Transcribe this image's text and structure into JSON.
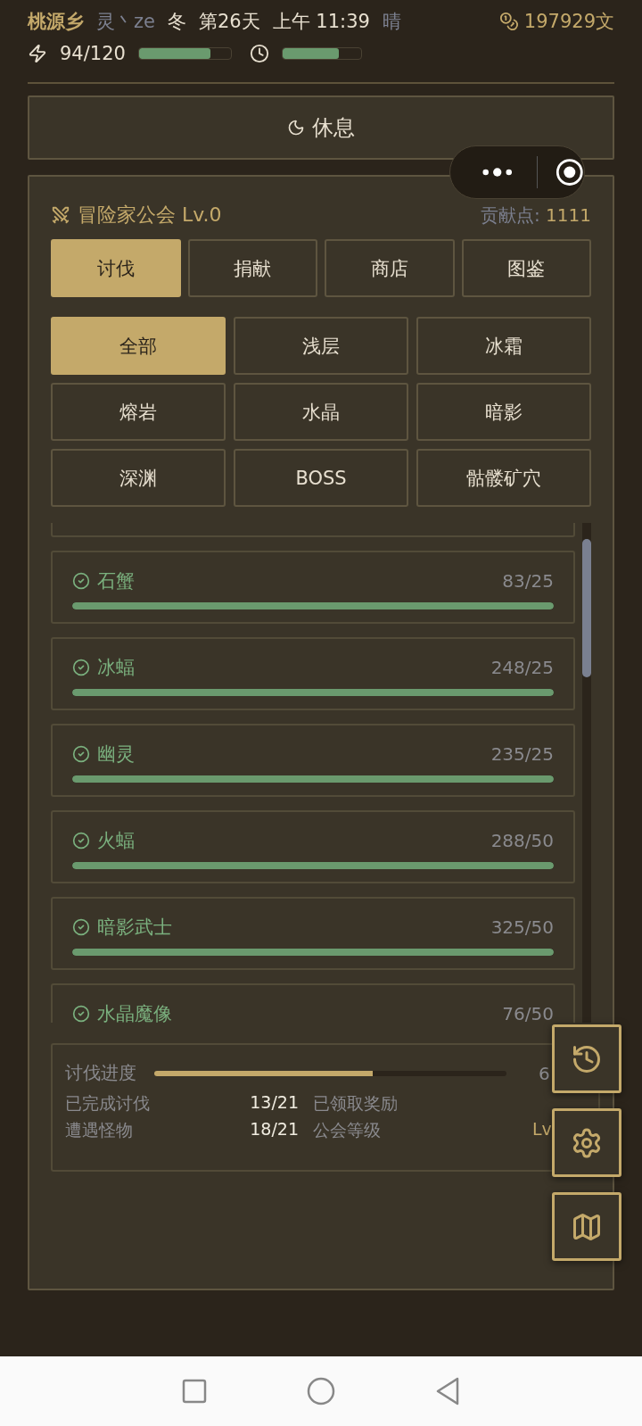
{
  "header": {
    "location": "桃源乡",
    "player": "灵丶ze",
    "season": "冬",
    "day": "第26天",
    "time": "上午 11:39",
    "weather": "晴",
    "money": "197929文"
  },
  "energy": {
    "reading": "94/120",
    "level": 0.78
  },
  "time_bar": {
    "level": 0.72
  },
  "rest_button": "休息",
  "guild": {
    "title": "冒险家公会 Lv.0",
    "points_label": "贡献点:",
    "points": "1111"
  },
  "tabs": [
    {
      "label": "讨伐",
      "selected": true
    },
    {
      "label": "捐献",
      "selected": false
    },
    {
      "label": "商店",
      "selected": false
    },
    {
      "label": "图鉴",
      "selected": false
    }
  ],
  "filters": [
    {
      "label": "全部",
      "selected": true
    },
    {
      "label": "浅层",
      "selected": false
    },
    {
      "label": "冰霜",
      "selected": false
    },
    {
      "label": "熔岩",
      "selected": false
    },
    {
      "label": "水晶",
      "selected": false
    },
    {
      "label": "暗影",
      "selected": false
    },
    {
      "label": "深渊",
      "selected": false
    },
    {
      "label": "BOSS",
      "selected": false
    },
    {
      "label": "骷髅矿穴",
      "selected": false
    }
  ],
  "bounties": [
    {
      "name": "石蟹",
      "count": "83/25",
      "level": 1,
      "done": true
    },
    {
      "name": "冰蝠",
      "count": "248/25",
      "level": 1,
      "done": true
    },
    {
      "name": "幽灵",
      "count": "235/25",
      "level": 1,
      "done": true
    },
    {
      "name": "火蝠",
      "count": "288/50",
      "level": 1,
      "done": true
    },
    {
      "name": "暗影武士",
      "count": "325/50",
      "level": 1,
      "done": true
    },
    {
      "name": "水晶魔像",
      "count": "76/50",
      "done": true
    }
  ],
  "summary": {
    "progress_label": "讨伐进度",
    "level": 0.62,
    "progress_reading": "6",
    "stats": [
      {
        "label": "已完成讨伐",
        "value": "13/21"
      },
      {
        "label": "已领取奖励"
      },
      {
        "label": "遭遇怪物",
        "value": "18/21"
      },
      {
        "label": "公会等级",
        "value": "Lv"
      }
    ]
  }
}
